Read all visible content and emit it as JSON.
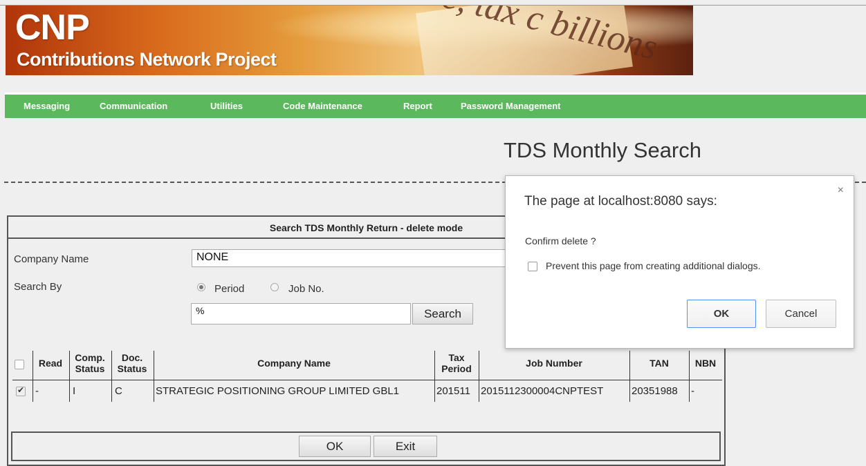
{
  "banner": {
    "logo_text": "CNP",
    "subtitle": "Contributions Network Project",
    "background_text": "re, tax c billions"
  },
  "nav": {
    "items": [
      "Messaging",
      "Communication",
      "Utilities",
      "Code Maintenance",
      "Report",
      "Password Management"
    ]
  },
  "page": {
    "title": "TDS Monthly Search"
  },
  "panel": {
    "header": "Search TDS Monthly Return - delete mode",
    "company_label": "Company Name",
    "company_value": "NONE",
    "search_by_label": "Search By",
    "radio_period": "Period",
    "radio_jobno": "Job No.",
    "search_value": "%",
    "search_button": "Search",
    "ok_button": "OK",
    "exit_button": "Exit"
  },
  "table": {
    "headers": {
      "read": "Read",
      "comp_status_1": "Comp.",
      "comp_status_2": "Status",
      "doc_status_1": "Doc.",
      "doc_status_2": "Status",
      "company_name": "Company Name",
      "tax_period_1": "Tax",
      "tax_period_2": "Period",
      "job_number": "Job Number",
      "tan": "TAN",
      "nbn": "NBN"
    },
    "rows": [
      {
        "checked": true,
        "read": "-",
        "comp_status": "I",
        "doc_status": "C",
        "company_name": "STRATEGIC POSITIONING GROUP LIMITED GBL1",
        "tax_period": "201511",
        "job_number": "2015112300004CNPTEST",
        "tan": "20351988",
        "nbn": "-"
      }
    ]
  },
  "dialog": {
    "title": "The page at localhost:8080 says:",
    "message": "Confirm delete ?",
    "checkbox_label": "Prevent this page from creating additional dialogs.",
    "ok_label": "OK",
    "cancel_label": "Cancel",
    "close_glyph": "×"
  },
  "colors": {
    "nav_green": "#5cb85c",
    "dialog_focus": "#4d90fe"
  }
}
